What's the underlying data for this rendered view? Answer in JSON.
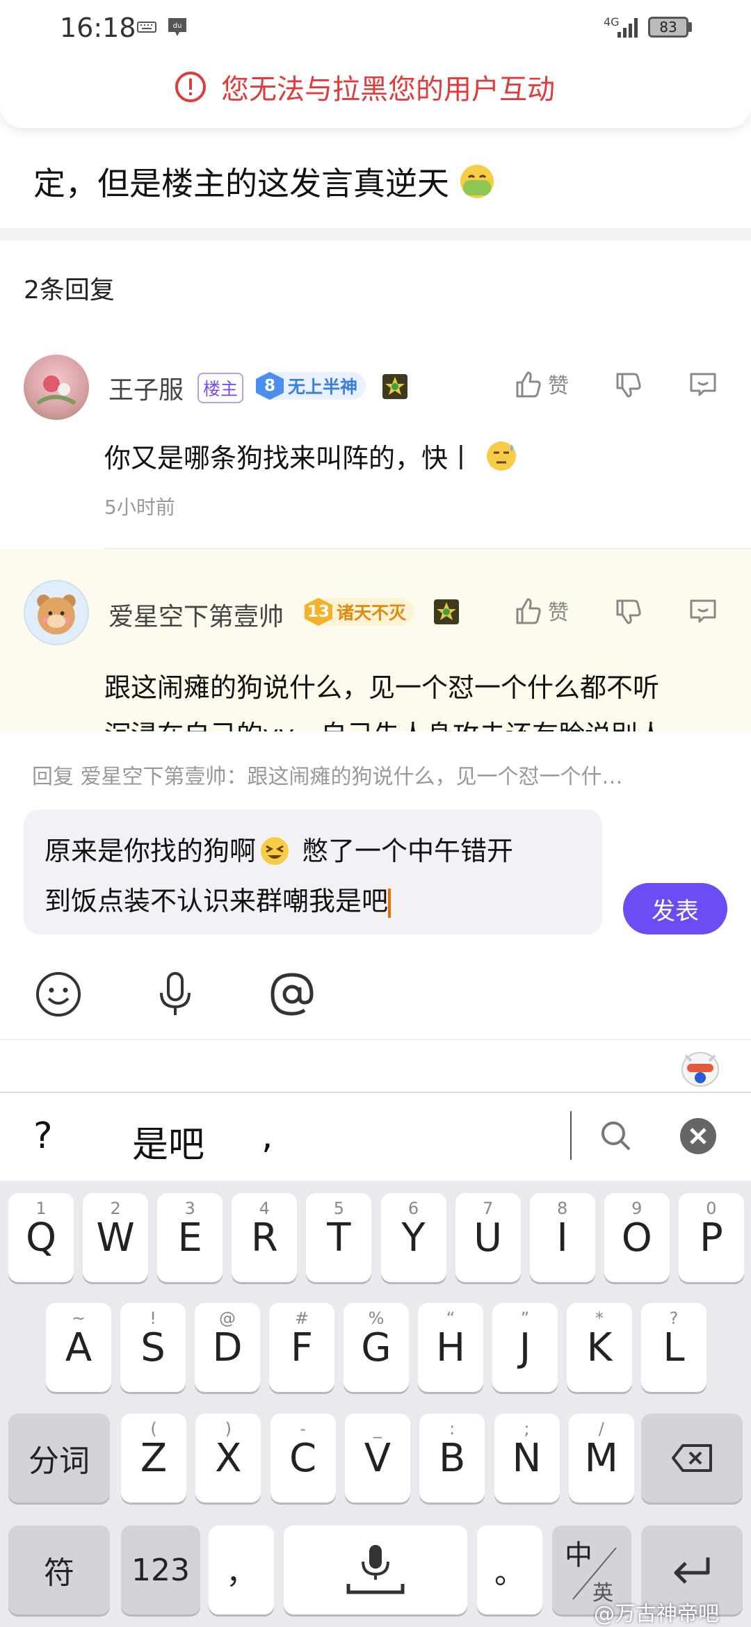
{
  "status_bar": {
    "time": "16:18",
    "battery": "83",
    "signal": "4G"
  },
  "banner": {
    "message": "您无法与拉黑您的用户互动"
  },
  "post": {
    "tail_text": "定，但是楼主的这发言真逆天"
  },
  "replies": {
    "count_label": "2条回复",
    "items": [
      {
        "username": "王子服",
        "host_badge": "楼主",
        "level": "8",
        "level_title": "无上半神",
        "like_label": "赞",
        "text": "你又是哪条狗找来叫阵的，快丨",
        "time": "5小时前"
      },
      {
        "username": "爱星空下第壹帅",
        "level": "13",
        "level_title": "诸天不灭",
        "like_label": "赞",
        "text_line1": "跟这闹瘫的狗说什么，见一个怼一个什么都不听",
        "text_line2": "沉浸在自己的yy，自己先人身攻击还有脸说别人"
      }
    ]
  },
  "composer": {
    "reply_to": "回复 爱星空下第壹帅：跟这闹瘫的狗说什么，见一个怼一个什…",
    "input_line1a": "原来是你找的狗啊",
    "input_line1b": "憋了一个中午错开",
    "input_line2": "到饭点装不认识来群嘲我是吧",
    "send_label": "发表"
  },
  "ime": {
    "candidates": [
      "?",
      "是吧",
      ","
    ],
    "row1": [
      [
        "1",
        "Q"
      ],
      [
        "2",
        "W"
      ],
      [
        "3",
        "E"
      ],
      [
        "4",
        "R"
      ],
      [
        "5",
        "T"
      ],
      [
        "6",
        "Y"
      ],
      [
        "7",
        "U"
      ],
      [
        "8",
        "I"
      ],
      [
        "9",
        "O"
      ],
      [
        "0",
        "P"
      ]
    ],
    "row2": [
      [
        "~",
        "A"
      ],
      [
        "!",
        "S"
      ],
      [
        "@",
        "D"
      ],
      [
        "#",
        "F"
      ],
      [
        "%",
        "G"
      ],
      [
        "“",
        "H"
      ],
      [
        "”",
        "J"
      ],
      [
        "*",
        "K"
      ],
      [
        "?",
        "L"
      ]
    ],
    "row3": [
      [
        "(",
        "Z"
      ],
      [
        ")",
        "X"
      ],
      [
        "-",
        "C"
      ],
      [
        "_",
        "V"
      ],
      [
        ":",
        "B"
      ],
      [
        ";",
        "N"
      ],
      [
        "/",
        "M"
      ]
    ],
    "fenci_label": "分词",
    "fu_label": "符",
    "num_label": "123",
    "comma_label": "，",
    "period_label": "。",
    "lang_top": "中",
    "lang_bottom": "英"
  },
  "watermark": "@万古神帝吧",
  "colors": {
    "accent": "#6c4cf5",
    "alert": "#e03a3a",
    "highlight_bg": "#fdfbee"
  }
}
